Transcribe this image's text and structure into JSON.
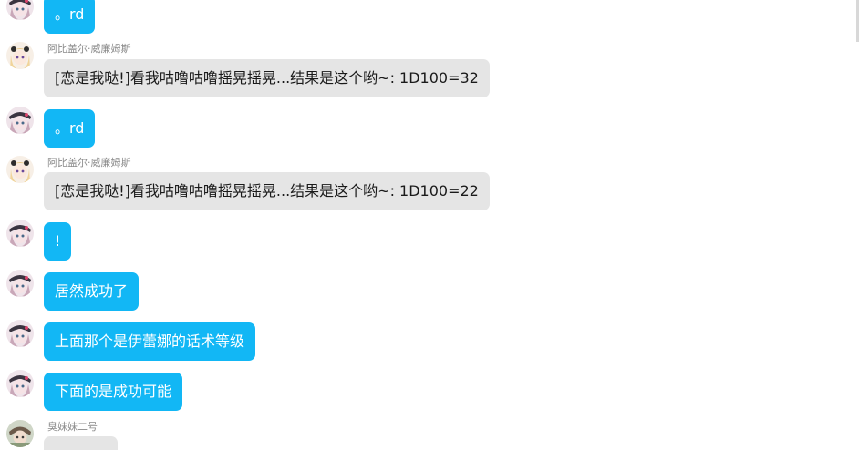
{
  "messages": [
    {
      "kind": "self",
      "text": "。rd",
      "avatar": "self-avatar-icon"
    },
    {
      "kind": "other",
      "sender": "阿比盖尔·威廉姆斯",
      "text": "[恋是我哒!]看我咕噜咕噜摇晃摇晃...结果是这个哟~: 1D100=32",
      "avatar": "abigail-avatar-icon"
    },
    {
      "kind": "self",
      "text": "。rd",
      "avatar": "self-avatar-icon"
    },
    {
      "kind": "other",
      "sender": "阿比盖尔·威廉姆斯",
      "text": "[恋是我哒!]看我咕噜咕噜摇晃摇晃...结果是这个哟~: 1D100=22",
      "avatar": "abigail-avatar-icon"
    },
    {
      "kind": "self",
      "text": "!",
      "avatar": "self-avatar-icon"
    },
    {
      "kind": "self",
      "text": "居然成功了",
      "avatar": "self-avatar-icon"
    },
    {
      "kind": "self",
      "text": "上面那个是伊蕾娜的话术等级",
      "avatar": "self-avatar-icon"
    },
    {
      "kind": "self",
      "text": "下面的是成功可能",
      "avatar": "self-avatar-icon"
    },
    {
      "kind": "other",
      "sender": "臭妹妹二号",
      "text": "",
      "avatar": "sister-avatar-icon"
    }
  ],
  "colors": {
    "self_bubble": "#12b7f5",
    "other_bubble": "#e5e5e5",
    "sender_text": "#8a8a8a"
  }
}
